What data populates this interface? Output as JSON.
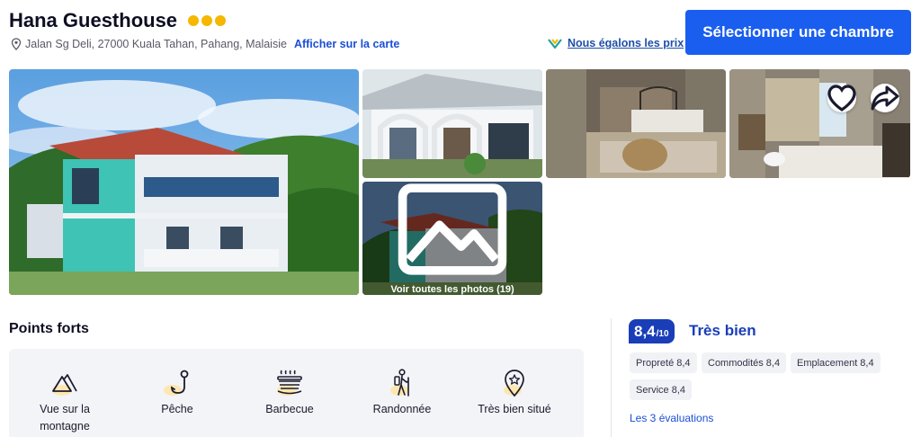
{
  "hotel": {
    "name": "Hana Guesthouse",
    "rating_dots": 3,
    "address": "Jalan Sg Deli, 27000 Kuala Tahan, Pahang, Malaisie",
    "map_link": "Afficher sur la carte",
    "price_match": "Nous égalons les prix",
    "select_button": "Sélectionner une chambre"
  },
  "gallery": {
    "see_all_label": "Voir toutes les photos (19)",
    "favorite_icon": "heart-icon",
    "share_icon": "share-icon"
  },
  "highlights": {
    "title": "Points forts",
    "items": [
      {
        "label": "Vue sur la montagne",
        "icon": "mountain-icon"
      },
      {
        "label": "Pêche",
        "icon": "fishing-icon"
      },
      {
        "label": "Barbecue",
        "icon": "barbecue-icon"
      },
      {
        "label": "Randonnée",
        "icon": "hiking-icon"
      },
      {
        "label": "Très bien situé",
        "icon": "location-star-icon"
      }
    ]
  },
  "review": {
    "score": "8,4",
    "scale": "/10",
    "verdict": "Très bien",
    "categories": [
      {
        "label": "Propreté 8,4"
      },
      {
        "label": "Commodités 8,4"
      },
      {
        "label": "Emplacement 8,4"
      },
      {
        "label": "Service 8,4"
      }
    ],
    "reviews_link": "Les 3 évaluations"
  },
  "colors": {
    "primary": "#1a5ef0",
    "score_badge": "#1a3eb8",
    "star": "#f5b700",
    "link": "#1a4fd6"
  }
}
